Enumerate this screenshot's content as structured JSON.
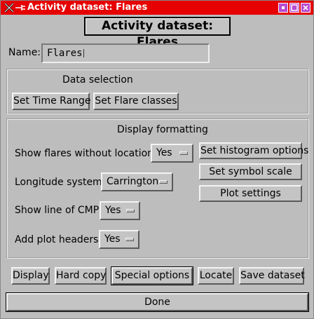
{
  "window": {
    "title": "Activity dataset: Flares"
  },
  "heading": "Activity dataset: Flares",
  "name": {
    "label": "Name:",
    "value": "Flares"
  },
  "data_selection": {
    "title": "Data selection",
    "set_time_range": "Set Time Range",
    "set_flare_classes": "Set Flare classes"
  },
  "display_formatting": {
    "title": "Display formatting",
    "show_flares_without_locations": {
      "label": "Show flares without locations:",
      "value": "Yes"
    },
    "longitude_system": {
      "label": "Longitude system:",
      "value": "Carrington"
    },
    "show_line_of_cmp": {
      "label": "Show line of CMP:",
      "value": "Yes"
    },
    "add_plot_headers": {
      "label": "Add plot headers:",
      "value": "Yes"
    },
    "set_histogram_options": "Set histogram options",
    "set_symbol_scale": "Set symbol scale",
    "plot_settings": "Plot settings"
  },
  "actions": {
    "display": "Display",
    "hard_copy": "Hard copy",
    "special_options": "Special options",
    "locate": "Locate",
    "save_dataset": "Save dataset"
  },
  "done": "Done",
  "colors": {
    "titlebar": "#e60000",
    "window_bg": "#bdbdbd",
    "titlebar_buttons": "#b84bd0"
  },
  "icons": [
    "close-x-icon",
    "pin-icon",
    "minimize-icon",
    "maximize-icon",
    "close-icon"
  ]
}
